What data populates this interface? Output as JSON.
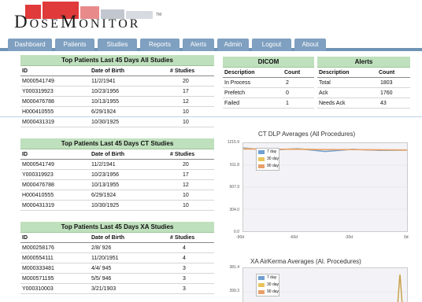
{
  "app": {
    "logo_text": "DoseMonitor",
    "logo_tm": "TM"
  },
  "nav": {
    "tabs": [
      "Dashboard",
      "Patients",
      "Studies",
      "Reports",
      "Alerts",
      "Admin",
      "Logout",
      "About"
    ]
  },
  "top_all": {
    "title": "Top Patients Last 45 Days All Studies",
    "headers": [
      "ID",
      "Date of Birth",
      "# Studies"
    ],
    "rows": [
      [
        "M000541749",
        "11/2/1941",
        "20"
      ],
      [
        "Y000319923",
        "10/23/1956",
        "17"
      ],
      [
        "M000476788",
        "10/13/1955",
        "12"
      ],
      [
        "H000410555",
        "6/29/1924",
        "10"
      ],
      [
        "M000431319",
        "10/30/1925",
        "10"
      ]
    ]
  },
  "top_ct": {
    "title": "Top Patients Last 45 Days CT Studies",
    "headers": [
      "ID",
      "Date of Birth",
      "# Studies"
    ],
    "rows": [
      [
        "M000541749",
        "11/2/1941",
        "20"
      ],
      [
        "Y000319923",
        "10/23/1956",
        "17"
      ],
      [
        "M000476788",
        "10/13/1955",
        "12"
      ],
      [
        "H000410555",
        "6/29/1924",
        "10"
      ],
      [
        "M000431319",
        "10/30/1925",
        "10"
      ]
    ]
  },
  "top_xa": {
    "title": "Top Patients Last 45 Days XA Studies",
    "headers": [
      "ID",
      "Date of Birth",
      "# Studies"
    ],
    "rows": [
      [
        "M000258176",
        "2/8/ 926",
        "4"
      ],
      [
        "M000554111",
        "11/20/1951",
        "4"
      ],
      [
        "M000333481",
        "4/4/ 945",
        "3"
      ],
      [
        "M000571195",
        "5/5/ 946",
        "3"
      ],
      [
        "Y000310003",
        "3/21/1903",
        "3"
      ]
    ]
  },
  "dicom": {
    "title": "DICOM",
    "headers": [
      "Description",
      "Count"
    ],
    "rows": [
      [
        "In Process",
        "2"
      ],
      [
        "Prefetch",
        "0"
      ],
      [
        "Failed",
        "1"
      ]
    ]
  },
  "alerts": {
    "title": "Alerts",
    "headers": [
      "Description",
      "Count"
    ],
    "rows": [
      [
        "Total",
        "1803"
      ],
      [
        "Ack",
        "1760"
      ],
      [
        "Needs Ack",
        "43"
      ]
    ]
  },
  "ct_chart": {
    "title": "CT DLP Averages (All Procedures)",
    "y_ticks": [
      "1215.9",
      "911.8",
      "607.9",
      "304.0",
      "0.0"
    ],
    "x_ticks": [
      "-90d",
      "-60d",
      "-30d",
      "0d"
    ],
    "legend": [
      "7 day",
      "30 day",
      "90 day"
    ],
    "colors": [
      "#6f9fd0",
      "#e8c45a",
      "#e8a06a"
    ]
  },
  "xa_chart": {
    "title": "XA AirKerma Averages (Al. Procedures)",
    "y_ticks": [
      "381.4",
      "399.3"
    ],
    "legend": [
      "7 day",
      "30 day",
      "90 day"
    ],
    "colors": [
      "#6f9fd0",
      "#e8c45a",
      "#e8a06a"
    ]
  },
  "chart_data": [
    {
      "type": "line",
      "title": "CT DLP Averages (All Procedures)",
      "xlabel": "",
      "ylabel": "",
      "x": [
        -90,
        -75,
        -60,
        -45,
        -30,
        -15,
        0
      ],
      "xlim": [
        -90,
        0
      ],
      "ylim": [
        0,
        1215.9
      ],
      "series": [
        {
          "name": "7 day",
          "values": [
            1150,
            1120,
            1140,
            1100,
            1130,
            1115,
            1120
          ]
        },
        {
          "name": "30 day",
          "values": [
            1140,
            1130,
            1135,
            1125,
            1128,
            1122,
            1120
          ]
        },
        {
          "name": "90 day",
          "values": [
            1135,
            1132,
            1130,
            1128,
            1126,
            1124,
            1122
          ]
        }
      ]
    }
  ]
}
